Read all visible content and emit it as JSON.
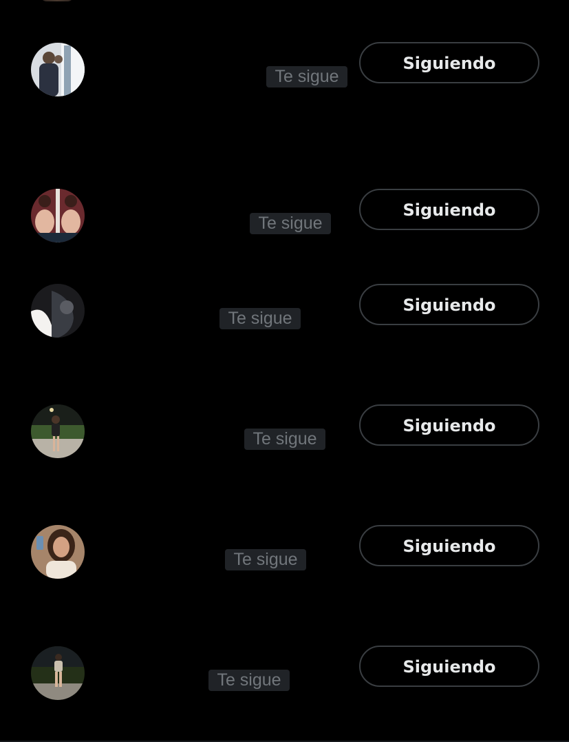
{
  "colors": {
    "background": "#000000",
    "badge_bg": "#202327",
    "badge_text": "#71767b",
    "button_border": "#3a3e42",
    "button_text": "#e7e9ea"
  },
  "rows": [
    {
      "avatar": "avatar-photo-1",
      "follows_you": "Te sigue",
      "button_label": "Siguiendo"
    },
    {
      "avatar": "avatar-photo-2",
      "follows_you": "Te sigue",
      "button_label": "Siguiendo"
    },
    {
      "avatar": "avatar-photo-3",
      "follows_you": "Te sigue",
      "button_label": "Siguiendo"
    },
    {
      "avatar": "avatar-photo-4",
      "follows_you": "Te sigue",
      "button_label": "Siguiendo"
    },
    {
      "avatar": "avatar-photo-5",
      "follows_you": "Te sigue",
      "button_label": "Siguiendo"
    },
    {
      "avatar": "avatar-photo-6",
      "follows_you": "Te sigue",
      "button_label": "Siguiendo"
    }
  ]
}
